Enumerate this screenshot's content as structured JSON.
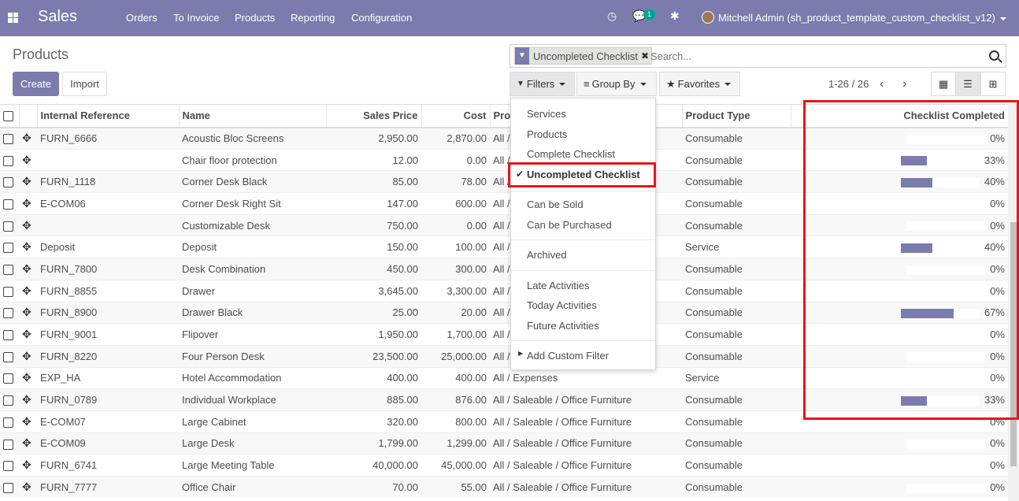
{
  "navbar": {
    "app_name": "Sales",
    "menu": [
      "Orders",
      "To Invoice",
      "Products",
      "Reporting",
      "Configuration"
    ],
    "messages_badge": "1",
    "user": "Mitchell Admin (sh_product_template_custom_checklist_v12)"
  },
  "page": {
    "title": "Products",
    "create_label": "Create",
    "import_label": "Import"
  },
  "search": {
    "facet_label": "Uncompleted Checklist",
    "placeholder": "Search...",
    "filters_label": "Filters",
    "groupby_label": "Group By",
    "favorites_label": "Favorites"
  },
  "pager": {
    "text": "1-26 / 26"
  },
  "filters_menu": {
    "items": [
      "Services",
      "Products",
      "Complete Checklist",
      "Uncompleted Checklist",
      "Can be Sold",
      "Can be Purchased",
      "Archived",
      "Late Activities",
      "Today Activities",
      "Future Activities",
      "Add Custom Filter"
    ],
    "selected": "Uncompleted Checklist"
  },
  "table": {
    "columns": [
      "Internal Reference",
      "Name",
      "Sales Price",
      "Cost",
      "Pro",
      "Product Type",
      "Checklist Completed"
    ],
    "rows": [
      {
        "ref": "FURN_6666",
        "name": "Acoustic Bloc Screens",
        "price": "2,950.00",
        "cost": "2,870.00",
        "category": "All /",
        "type": "Consumable",
        "pct": "0%",
        "fill": 0
      },
      {
        "ref": "",
        "name": "Chair floor protection",
        "price": "12.00",
        "cost": "0.00",
        "category": "All /",
        "type": "Consumable",
        "pct": "33%",
        "fill": 33
      },
      {
        "ref": "FURN_1118",
        "name": "Corner Desk Black",
        "price": "85.00",
        "cost": "78.00",
        "category": "All /",
        "type": "Consumable",
        "pct": "40%",
        "fill": 40
      },
      {
        "ref": "E-COM06",
        "name": "Corner Desk Right Sit",
        "price": "147.00",
        "cost": "600.00",
        "category": "All /",
        "type": "Consumable",
        "pct": "0%",
        "fill": 0
      },
      {
        "ref": "",
        "name": "Customizable Desk",
        "price": "750.00",
        "cost": "0.00",
        "category": "All /",
        "type": "Consumable",
        "pct": "0%",
        "fill": 0
      },
      {
        "ref": "Deposit",
        "name": "Deposit",
        "price": "150.00",
        "cost": "100.00",
        "category": "All /",
        "type": "Service",
        "pct": "40%",
        "fill": 40
      },
      {
        "ref": "FURN_7800",
        "name": "Desk Combination",
        "price": "450.00",
        "cost": "300.00",
        "category": "All /",
        "type": "Consumable",
        "pct": "0%",
        "fill": 0
      },
      {
        "ref": "FURN_8855",
        "name": "Drawer",
        "price": "3,645.00",
        "cost": "3,300.00",
        "category": "All /",
        "type": "Consumable",
        "pct": "0%",
        "fill": 0
      },
      {
        "ref": "FURN_8900",
        "name": "Drawer Black",
        "price": "25.00",
        "cost": "20.00",
        "category": "All /",
        "type": "Consumable",
        "pct": "67%",
        "fill": 67
      },
      {
        "ref": "FURN_9001",
        "name": "Flipover",
        "price": "1,950.00",
        "cost": "1,700.00",
        "category": "All /",
        "type": "Consumable",
        "pct": "0%",
        "fill": 0
      },
      {
        "ref": "FURN_8220",
        "name": "Four Person Desk",
        "price": "23,500.00",
        "cost": "25,000.00",
        "category": "All /",
        "type": "Consumable",
        "pct": "0%",
        "fill": 0
      },
      {
        "ref": "EXP_HA",
        "name": "Hotel Accommodation",
        "price": "400.00",
        "cost": "400.00",
        "category": "All / Expenses",
        "type": "Service",
        "pct": "0%",
        "fill": 0
      },
      {
        "ref": "FURN_0789",
        "name": "Individual Workplace",
        "price": "885.00",
        "cost": "876.00",
        "category": "All / Saleable / Office Furniture",
        "type": "Consumable",
        "pct": "33%",
        "fill": 33
      },
      {
        "ref": "E-COM07",
        "name": "Large Cabinet",
        "price": "320.00",
        "cost": "800.00",
        "category": "All / Saleable / Office Furniture",
        "type": "Consumable",
        "pct": "0%",
        "fill": 0
      },
      {
        "ref": "E-COM09",
        "name": "Large Desk",
        "price": "1,799.00",
        "cost": "1,299.00",
        "category": "All / Saleable / Office Furniture",
        "type": "Consumable",
        "pct": "0%",
        "fill": 0
      },
      {
        "ref": "FURN_6741",
        "name": "Large Meeting Table",
        "price": "40,000.00",
        "cost": "45,000.00",
        "category": "All / Saleable / Office Furniture",
        "type": "Consumable",
        "pct": "0%",
        "fill": 0
      },
      {
        "ref": "FURN_7777",
        "name": "Office Chair",
        "price": "70.00",
        "cost": "55.00",
        "category": "All / Saleable / Office Furniture",
        "type": "Consumable",
        "pct": "0%",
        "fill": 0
      }
    ]
  },
  "colors": {
    "brand": "#7c7bad",
    "highlight": "#e8151b",
    "badge": "#00a09d"
  }
}
